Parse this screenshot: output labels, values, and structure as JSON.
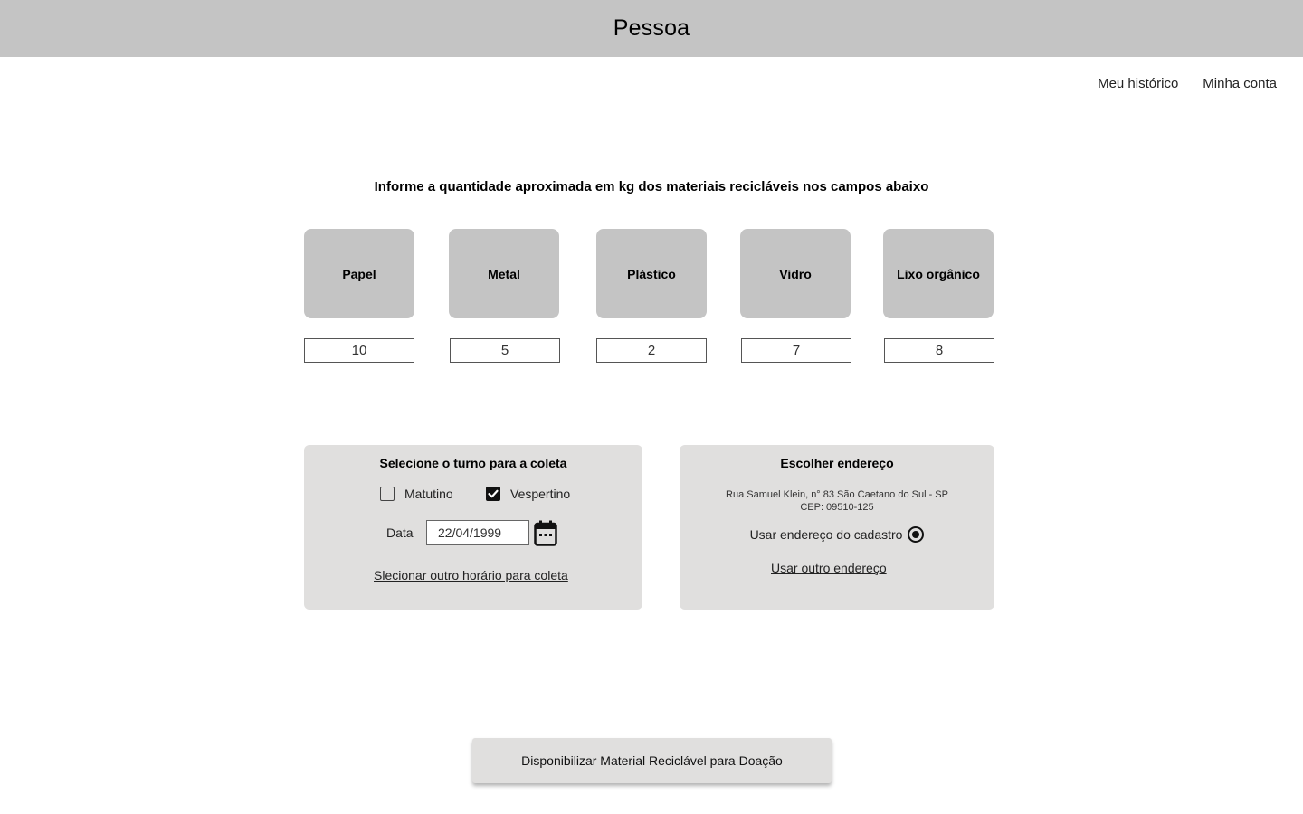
{
  "header": {
    "title": "Pessoa"
  },
  "nav": {
    "history": "Meu histórico",
    "account": "Minha conta"
  },
  "instruction": "Informe a quantidade aproximada em kg dos materiais recicláveis nos campos abaixo",
  "materials": [
    {
      "label": "Papel",
      "quantity": "10"
    },
    {
      "label": "Metal",
      "quantity": "5"
    },
    {
      "label": "Plástico",
      "quantity": "2"
    },
    {
      "label": "Vidro",
      "quantity": "7"
    },
    {
      "label": "Lixo orgânico",
      "quantity": "8"
    }
  ],
  "shift_panel": {
    "title": "Selecione o turno para a coleta",
    "options": [
      {
        "label": "Matutino",
        "checked": false
      },
      {
        "label": "Vespertino",
        "checked": true
      }
    ],
    "date_label": "Data",
    "date_value": "22/04/1999",
    "other_time_link": "Slecionar outro horário para coleta",
    "calendar_icon": "calendar-icon"
  },
  "address_panel": {
    "title": "Escolher endereço",
    "address_line1": "Rua Samuel Klein, n° 83 São Caetano do Sul - SP",
    "address_line2": "CEP: 09510-125",
    "use_registered_label": "Usar endereço do cadastro",
    "use_registered_selected": true,
    "other_address_link": "Usar outro endereço"
  },
  "submit_label": "Disponibilizar Material Reciclável para Doação",
  "colors": {
    "header_bg": "#c4c4c4",
    "tile_bg": "#c4c4c4",
    "panel_bg": "#e0dfde"
  }
}
